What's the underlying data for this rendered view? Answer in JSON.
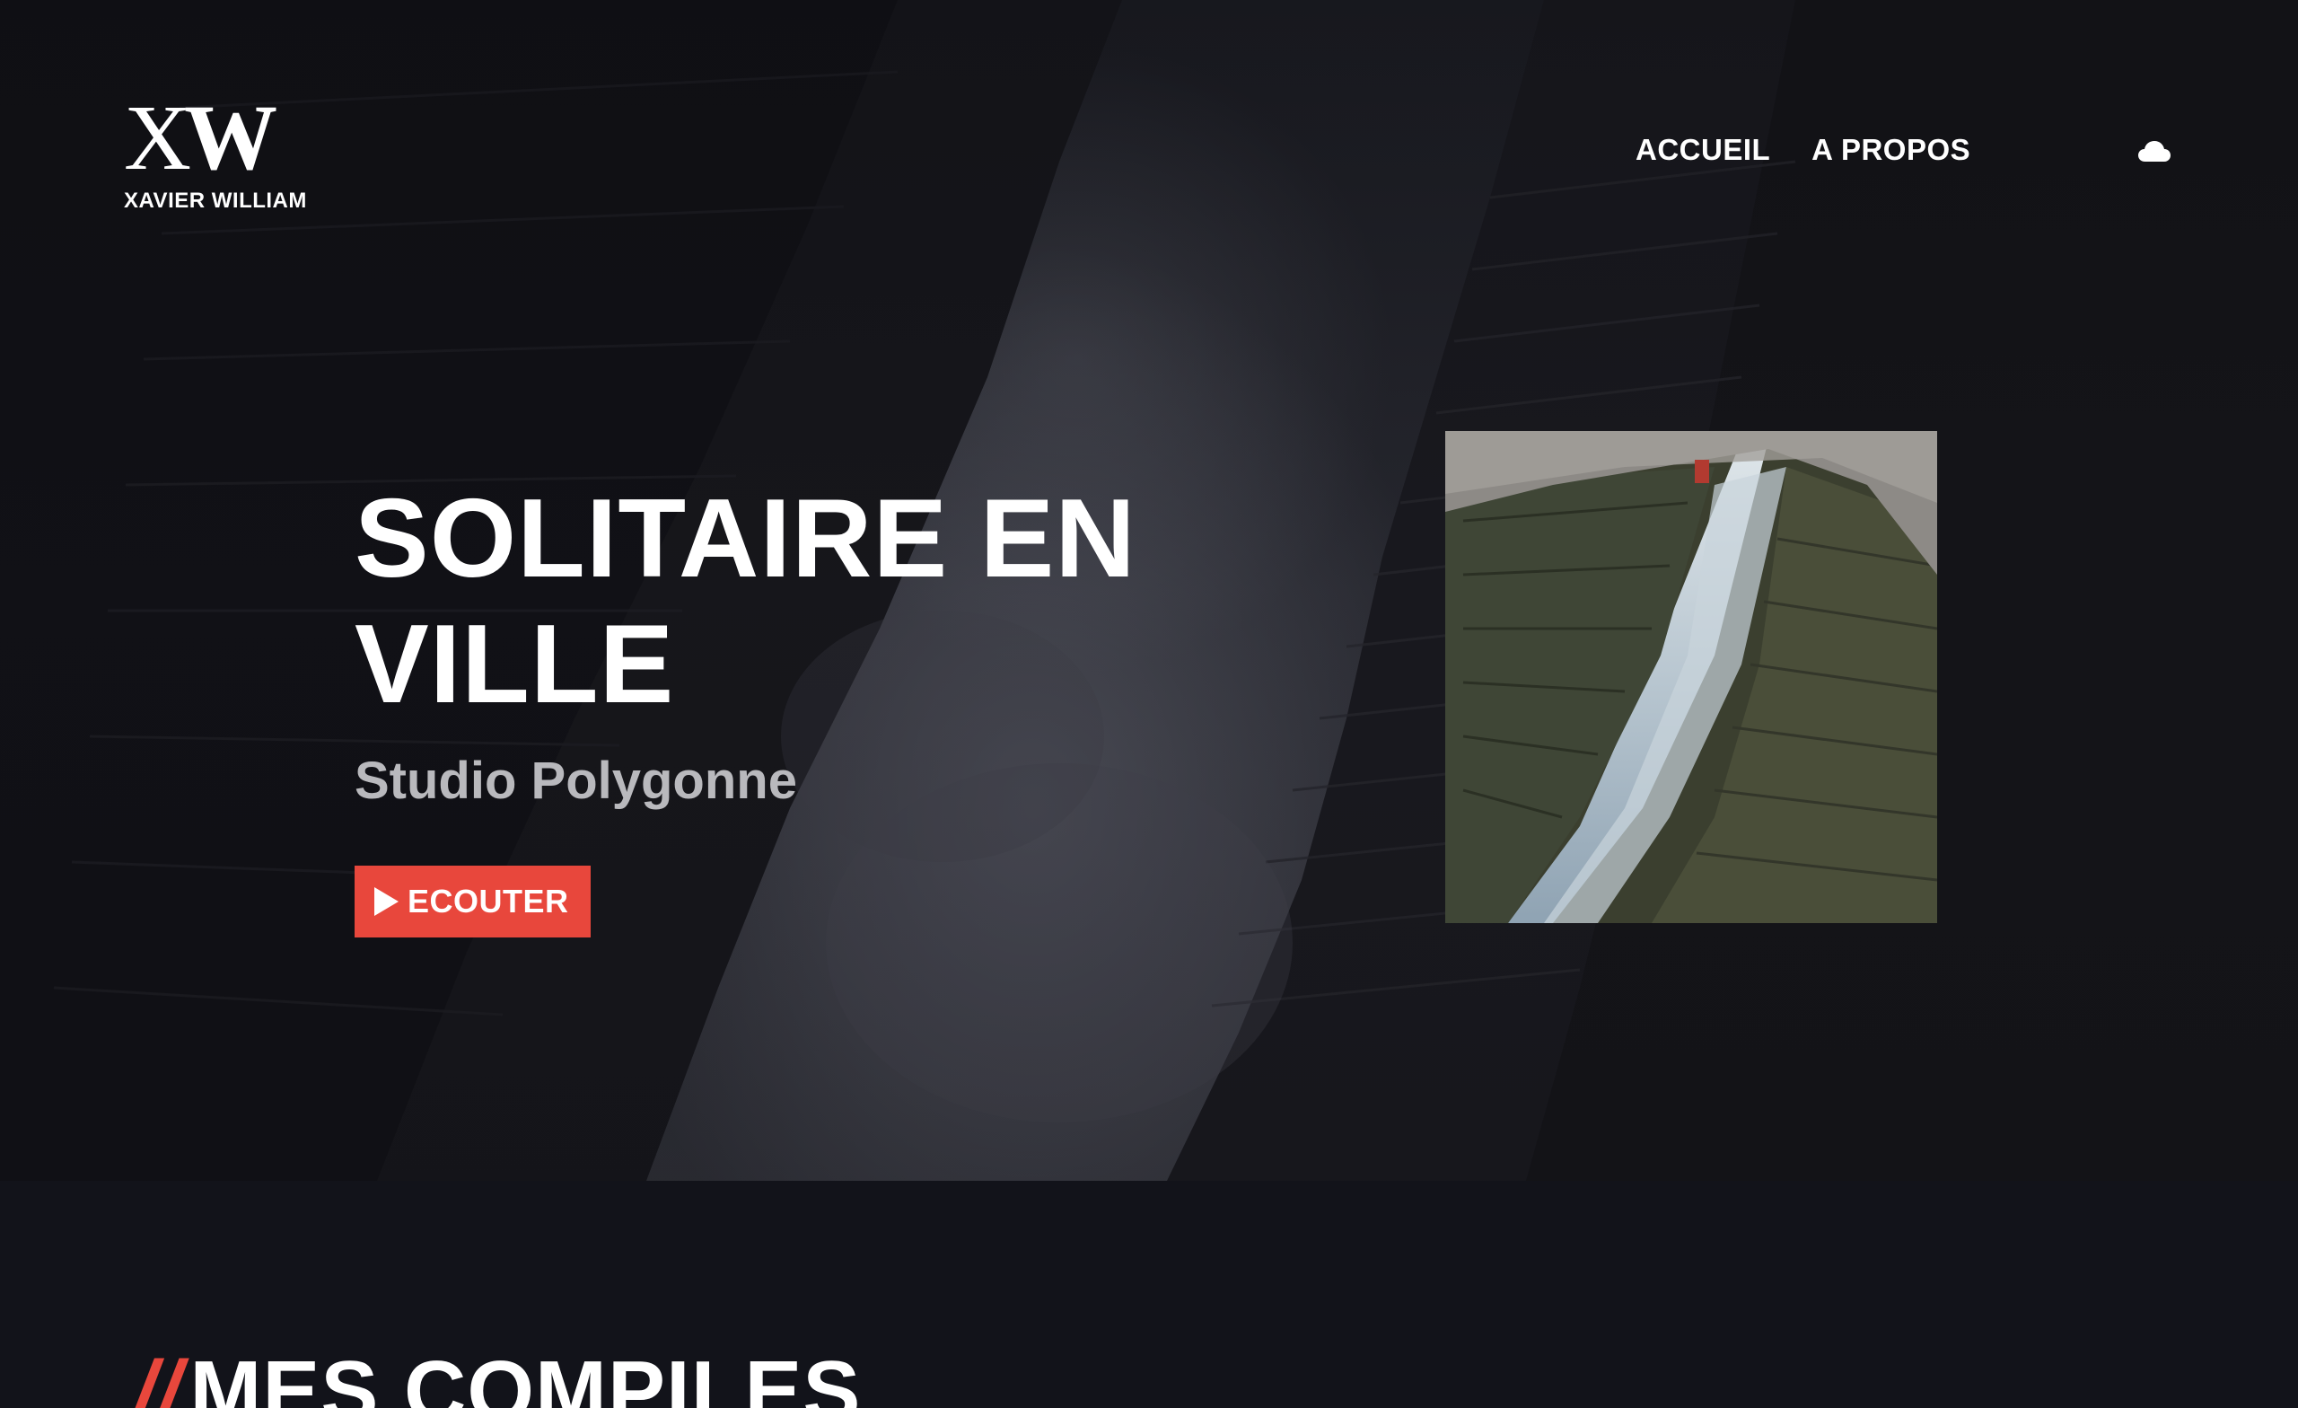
{
  "header": {
    "logo": {
      "mark_x": "X",
      "mark_w": "W",
      "name": "XAVIER WILLIAM"
    },
    "nav": [
      {
        "label": "ACCUEIL"
      },
      {
        "label": "A PROPOS"
      }
    ],
    "cloud_icon": "cloud-icon"
  },
  "hero": {
    "title": "SOLITAIRE EN VILLE",
    "subtitle": "Studio Polygonne",
    "listen_button": {
      "icon": "play-icon",
      "label": "ECOUTER"
    },
    "accent_color": "#e8473c"
  },
  "section": {
    "heading_prefix": "//",
    "heading": "MES COMPILES"
  }
}
